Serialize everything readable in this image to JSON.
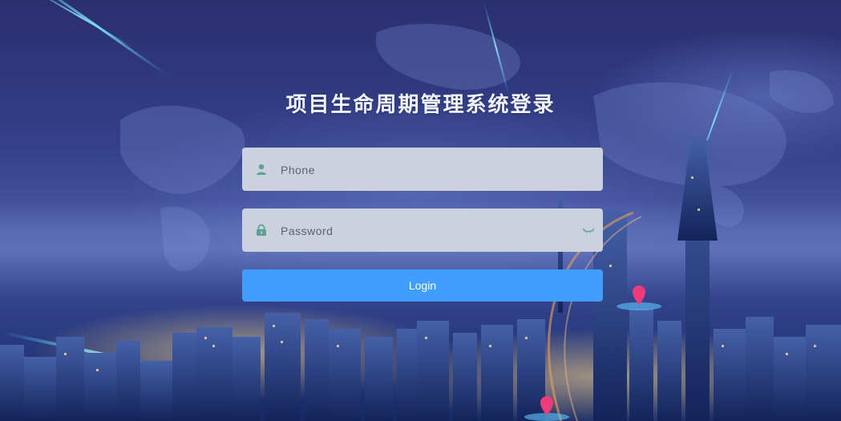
{
  "page": {
    "title": "项目生命周期管理系统登录"
  },
  "form": {
    "phone": {
      "placeholder": "Phone",
      "value": "",
      "icon": "user-icon"
    },
    "password": {
      "placeholder": "Password",
      "value": "",
      "icon": "lock-icon",
      "toggle_icon": "eye-closed-icon"
    },
    "login_label": "Login"
  },
  "colors": {
    "accent": "#409eff",
    "field_bg": "#cbd2dd",
    "icon": "#5aa392",
    "title": "#f2f4fb"
  }
}
